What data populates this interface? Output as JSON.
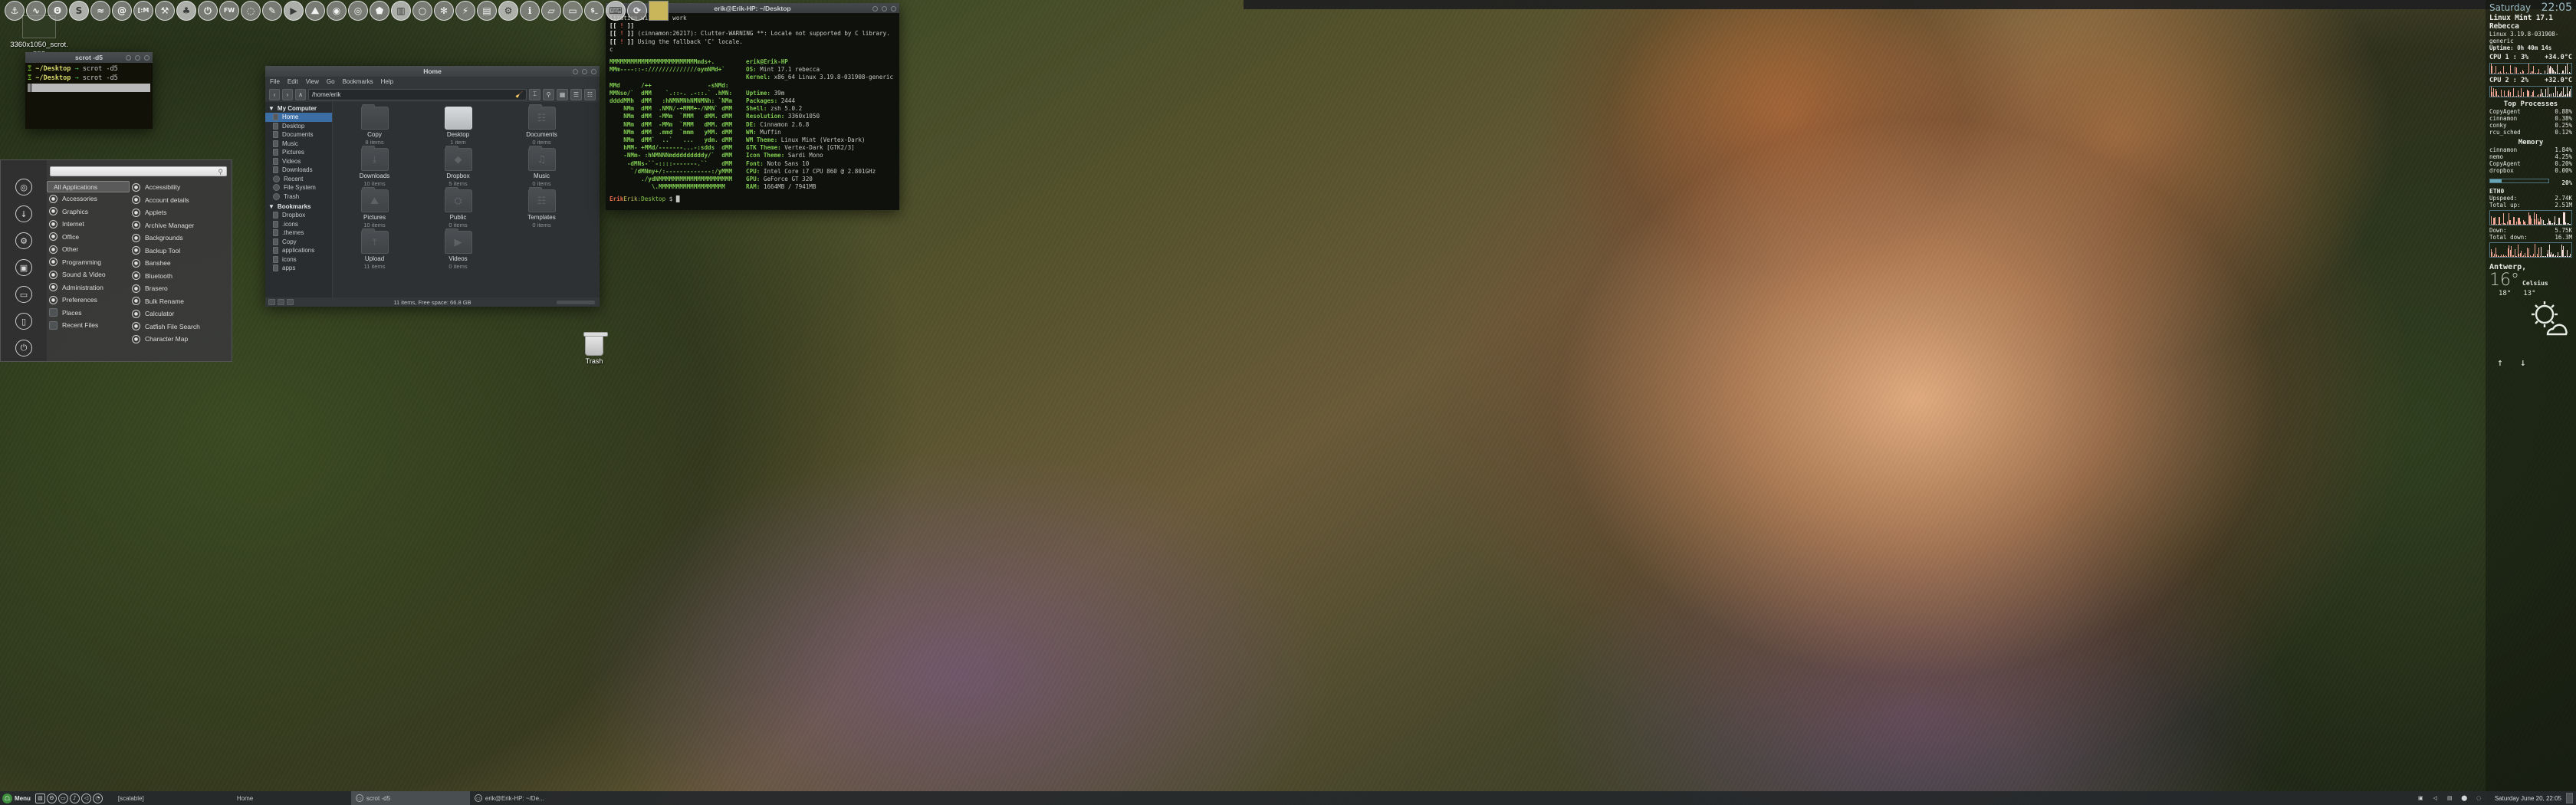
{
  "desktop": {
    "icon_label": "3360x1050_scrot.\npng",
    "trash_label": "Trash"
  },
  "dock": {
    "icons": [
      {
        "name": "anchor-icon",
        "glyph": "⚓"
      },
      {
        "name": "pulse-icon",
        "glyph": "∿"
      },
      {
        "name": "firefox-icon",
        "glyph": "Θ"
      },
      {
        "name": "skype-icon",
        "glyph": "S"
      },
      {
        "name": "spotify-icon",
        "glyph": "≈"
      },
      {
        "name": "email-icon",
        "glyph": "@"
      },
      {
        "name": "cm-icon",
        "glyph": "[:M"
      },
      {
        "name": "tools-icon",
        "glyph": "⚒"
      },
      {
        "name": "inkscape-icon",
        "glyph": "♣"
      },
      {
        "name": "power-icon",
        "glyph": "⏻"
      },
      {
        "name": "fw-icon",
        "glyph": "FW"
      },
      {
        "name": "dotted-circle-icon",
        "glyph": "◌"
      },
      {
        "name": "pencil-icon",
        "glyph": "✎"
      },
      {
        "name": "video-player-icon",
        "glyph": "▶"
      },
      {
        "name": "image-viewer-icon",
        "glyph": "⛰"
      },
      {
        "name": "globe-icon",
        "glyph": "◉"
      },
      {
        "name": "disc-icon",
        "glyph": "◎"
      },
      {
        "name": "shield-icon",
        "glyph": "⬟"
      },
      {
        "name": "ruler-icon",
        "glyph": "▥"
      },
      {
        "name": "circle-outline-icon",
        "glyph": "○"
      },
      {
        "name": "fan-icon",
        "glyph": "✻"
      },
      {
        "name": "plug-icon",
        "glyph": "⚡"
      },
      {
        "name": "hardware-icon",
        "glyph": "▤"
      },
      {
        "name": "gear-icon",
        "glyph": "⚙"
      },
      {
        "name": "info-icon",
        "glyph": "ℹ"
      },
      {
        "name": "folder-icon",
        "glyph": "▱"
      },
      {
        "name": "monitor-icon",
        "glyph": "▭"
      },
      {
        "name": "terminal-icon",
        "glyph": "$_"
      },
      {
        "name": "keyboard-icon",
        "glyph": "⌨"
      },
      {
        "name": "sync-icon",
        "glyph": "⟳"
      }
    ]
  },
  "small_terminal": {
    "title": "scrot -d5",
    "lines": [
      {
        "glyph": "Ξ",
        "path": "~/Desktop",
        "arrow": "→",
        "cmd": "scrot -d5"
      },
      {
        "glyph": "Ξ",
        "path": "~/Desktop",
        "arrow": "→",
        "cmd": "scrot -d5"
      }
    ]
  },
  "menu": {
    "search_placeholder": "",
    "favorites": [
      {
        "name": "lock-icon",
        "glyph": "◎"
      },
      {
        "name": "download-icon",
        "glyph": "↓"
      },
      {
        "name": "settings-icon",
        "glyph": "⚙"
      },
      {
        "name": "software-icon",
        "glyph": "▣"
      },
      {
        "name": "terminal-icon",
        "glyph": "▭"
      },
      {
        "name": "lock-screen-icon",
        "glyph": "▯"
      },
      {
        "name": "power-icon",
        "glyph": "⏻"
      }
    ],
    "all_applications": "All Applications",
    "categories": [
      {
        "label": "Accessories",
        "icon": "accessories-icon"
      },
      {
        "label": "Graphics",
        "icon": "graphics-icon"
      },
      {
        "label": "Internet",
        "icon": "internet-icon"
      },
      {
        "label": "Office",
        "icon": "office-icon"
      },
      {
        "label": "Other",
        "icon": "other-icon"
      },
      {
        "label": "Programming",
        "icon": "programming-icon"
      },
      {
        "label": "Sound & Video",
        "icon": "sound-video-icon"
      },
      {
        "label": "Administration",
        "icon": "administration-icon"
      },
      {
        "label": "Preferences",
        "icon": "preferences-icon"
      },
      {
        "label": "Places",
        "icon": "places-icon"
      },
      {
        "label": "Recent Files",
        "icon": "recent-files-icon"
      }
    ],
    "applications": [
      {
        "label": "Accessibility",
        "icon": "accessibility-icon"
      },
      {
        "label": "Account details",
        "icon": "account-details-icon"
      },
      {
        "label": "Applets",
        "icon": "applets-icon"
      },
      {
        "label": "Archive Manager",
        "icon": "archive-manager-icon"
      },
      {
        "label": "Backgrounds",
        "icon": "backgrounds-icon"
      },
      {
        "label": "Backup Tool",
        "icon": "backup-tool-icon"
      },
      {
        "label": "Banshee",
        "icon": "banshee-icon"
      },
      {
        "label": "Bluetooth",
        "icon": "bluetooth-icon"
      },
      {
        "label": "Brasero",
        "icon": "brasero-icon"
      },
      {
        "label": "Bulk Rename",
        "icon": "bulk-rename-icon"
      },
      {
        "label": "Calculator",
        "icon": "calculator-icon"
      },
      {
        "label": "Catfish File Search",
        "icon": "catfish-icon"
      },
      {
        "label": "Character Map",
        "icon": "character-map-icon"
      }
    ]
  },
  "nemo": {
    "title": "Home",
    "menubar": [
      "File",
      "Edit",
      "View",
      "Go",
      "Bookmarks",
      "Help"
    ],
    "nav": {
      "back": "‹",
      "forward": "›",
      "up": "∧"
    },
    "location": "/home/erik",
    "toolbar": {
      "split": "⌶",
      "search": "⚲"
    },
    "sidebar": {
      "my_computer": "My Computer",
      "computer_items": [
        {
          "label": "Home",
          "selected": true
        },
        {
          "label": "Desktop",
          "selected": false
        },
        {
          "label": "Documents",
          "selected": false
        },
        {
          "label": "Music",
          "selected": false
        },
        {
          "label": "Pictures",
          "selected": false
        },
        {
          "label": "Videos",
          "selected": false
        },
        {
          "label": "Downloads",
          "selected": false
        },
        {
          "label": "Recent",
          "selected": false
        },
        {
          "label": "File System",
          "selected": false
        },
        {
          "label": "Trash",
          "selected": false
        }
      ],
      "bookmarks_header": "Bookmarks",
      "bookmarks": [
        {
          "label": "Dropbox"
        },
        {
          "label": ".icons"
        },
        {
          "label": ".themes"
        },
        {
          "label": "Copy"
        },
        {
          "label": "applications"
        },
        {
          "label": "icons"
        },
        {
          "label": "apps"
        }
      ]
    },
    "files": [
      {
        "name": "Copy",
        "sub": "8 items",
        "kind": "folder"
      },
      {
        "name": "Desktop",
        "sub": "1 item",
        "kind": "photo"
      },
      {
        "name": "Documents",
        "sub": "0 items",
        "kind": "folder"
      },
      {
        "name": "Downloads",
        "sub": "10 items",
        "kind": "folder"
      },
      {
        "name": "Dropbox",
        "sub": "5 items",
        "kind": "folder"
      },
      {
        "name": "Music",
        "sub": "0 items",
        "kind": "folder"
      },
      {
        "name": "Pictures",
        "sub": "10 items",
        "kind": "folder"
      },
      {
        "name": "Public",
        "sub": "0 items",
        "kind": "folder"
      },
      {
        "name": "Templates",
        "sub": "0 items",
        "kind": "folder"
      },
      {
        "name": "Upload",
        "sub": "11 items",
        "kind": "folder"
      },
      {
        "name": "Videos",
        "sub": "0 items",
        "kind": "folder"
      }
    ],
    "status": "11 items, Free space: 66.8 GB"
  },
  "terminal": {
    "title": "erik@Erik-HP: ~/Desktop",
    "warnings": [
      "lization will not work",
      "[[ ! ]]",
      "[[ ! ]] (cinnamon:26217): Clutter-WARNING **: Locale not supported by C library.",
      "[[ ! ]] Using the fallback 'C' locale.",
      "c"
    ],
    "ascii": [
      "MMMMMMMMMMMMMMMMMMMMMMMMMmds+.",
      "MMm----::-://////////////oymNMd+`",
      "",
      "MMd      /++                -sNMd:",
      "MMNso/`  dMM    `.::-. .-::.` .hMN:",
      "ddddMMh  dMM   :hNMNMNhNMNMNh: `NMm",
      "    NMm  dMM  .NMN/-+MMM+-/NMN` dMM",
      "    NMm  dMM  -MMm  `MMM   dMM. dMM",
      "    NMm  dMM  -MMm  `MMM   dMM. dMM",
      "    NMm  dMM  .mmd  `mmm   yMM. dMM",
      "    NMm  dMM`  ..`   ...   ydm. dMM",
      "    hMM- +MMd/-------...-:sdds  dMM",
      "    -NMm- :hNMNNNmdddddddddy/`  dMM",
      "     -dMNs-``-::::-------.``    dMM",
      "      `/dMNmy+/:-------------:/yMMM",
      "         ./ydNMMMMMMMMMMMMMMMMMMMMM",
      "            \\.MMMMMMMMMMMMMMMMMMM"
    ],
    "neofetch": {
      "user_host": "erik@Erik-HP",
      "rows": [
        {
          "key": "OS:",
          "val": "Mint 17.1 rebecca"
        },
        {
          "key": "Kernel:",
          "val": "x86_64 Linux 3.19.8-031908-generic"
        },
        {
          "key": "",
          "val": ""
        },
        {
          "key": "Uptime:",
          "val": "39m"
        },
        {
          "key": "Packages:",
          "val": "2444"
        },
        {
          "key": "Shell:",
          "val": "zsh 5.0.2"
        },
        {
          "key": "Resolution:",
          "val": "3360x1050"
        },
        {
          "key": "DE:",
          "val": "Cinnamon 2.6.8"
        },
        {
          "key": "WM:",
          "val": "Muffin"
        },
        {
          "key": "WM Theme:",
          "val": "Linux Mint (Vertex-Dark)"
        },
        {
          "key": "GTK Theme:",
          "val": "Vertex-Dark [GTK2/3]"
        },
        {
          "key": "Icon Theme:",
          "val": "Sardi Mono"
        },
        {
          "key": "Font:",
          "val": "Noto Sans 10"
        },
        {
          "key": "CPU:",
          "val": "Intel Core i7 CPU 860 @ 2.801GHz"
        },
        {
          "key": "GPU:",
          "val": "GeForce GT 320"
        },
        {
          "key": "RAM:",
          "val": "1664MB / 7941MB"
        }
      ]
    },
    "prompt": {
      "user": "Erik",
      "host": "Erik",
      "dir": ":Desktop",
      "symbol": "$",
      "cursor": "█"
    }
  },
  "conky": {
    "day": "Saturday",
    "time": "22:05",
    "distro": "Linux Mint 17.1 Rebecca",
    "kernel": "Linux 3.19.8-031908-generic",
    "uptime": "Uptime: 0h 40m 14s",
    "cpu1_label": "CPU 1 : 3%",
    "cpu1_temp": "+34.0°C",
    "cpu2_label": "CPU 2 : 2%",
    "cpu2_temp": "+32.0°C",
    "top_processes_header": "Top Processes",
    "top_processes": [
      {
        "name": "CopyAgent",
        "value": "0.88%"
      },
      {
        "name": "cinnamon",
        "value": "0.38%"
      },
      {
        "name": "conky",
        "value": "0.25%"
      },
      {
        "name": "rcu_sched",
        "value": "0.12%"
      }
    ],
    "memory_header": "Memory",
    "memory_processes": [
      {
        "name": "cinnamon",
        "value": "1.84%"
      },
      {
        "name": "nemo",
        "value": "4.25%"
      },
      {
        "name": "CopyAgent",
        "value": "0.20%"
      },
      {
        "name": "dropbox",
        "value": "0.00%"
      }
    ],
    "memory_percent": "20%",
    "eth_label": "ETH0",
    "upspeed_label": "Upspeed:",
    "upspeed_value": "2.74K",
    "totalup_label": "Total up:",
    "totalup_value": "2.51M",
    "down_label": "Down:",
    "down_value": "5.75K",
    "totaldown_label": "Total down:",
    "totaldown_value": "16.3M",
    "city": "Antwerp,",
    "temp": "16°",
    "unit": "Celsius",
    "high": "18°",
    "low": "13°",
    "up_arrow": "↑",
    "down_arrow": "↓"
  },
  "taskbar": {
    "menu_label": "Menu",
    "applets": [
      {
        "name": "screenshot-applet-icon",
        "glyph": "▧"
      },
      {
        "name": "firefox-applet-icon",
        "glyph": "Θ"
      },
      {
        "name": "terminal-applet-icon",
        "glyph": "▭"
      },
      {
        "name": "media-applet-icon",
        "glyph": "♪"
      },
      {
        "name": "volume-applet-icon",
        "glyph": "◁"
      },
      {
        "name": "wifi-applet-icon",
        "glyph": "◔"
      }
    ],
    "windows": [
      {
        "label": "[scalable]",
        "active": false,
        "icon": ""
      },
      {
        "label": "Home",
        "active": false,
        "icon": ""
      },
      {
        "label": "scrot -d5",
        "active": true,
        "icon": "▭"
      },
      {
        "label": "erik@Erik-HP: ~/De...",
        "active": false,
        "icon": "▭"
      }
    ],
    "tray": [
      {
        "name": "display-tray-icon",
        "glyph": "▣"
      },
      {
        "name": "volume-tray-icon",
        "glyph": "◁"
      },
      {
        "name": "network-tray-icon",
        "glyph": "▤"
      },
      {
        "name": "update-tray-icon",
        "glyph": "⬤"
      },
      {
        "name": "dropbox-tray-icon",
        "glyph": "◌"
      }
    ],
    "clock": "Saturday June 20, 22:05",
    "show_desktop": "▮"
  }
}
